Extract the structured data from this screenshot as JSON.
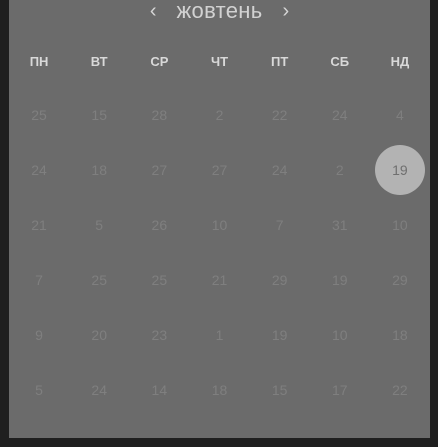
{
  "calendar": {
    "month": "жовтень",
    "prev_icon": "‹",
    "next_icon": "›",
    "weekdays": [
      "ПН",
      "ВТ",
      "СР",
      "ЧТ",
      "ПТ",
      "СБ",
      "НД"
    ],
    "weeks": [
      [
        "25",
        "15",
        "28",
        "2",
        "22",
        "24",
        "4"
      ],
      [
        "24",
        "18",
        "27",
        "27",
        "24",
        "2",
        "19"
      ],
      [
        "21",
        "5",
        "26",
        "10",
        "7",
        "31",
        "10"
      ],
      [
        "7",
        "25",
        "25",
        "21",
        "29",
        "19",
        "29"
      ],
      [
        "9",
        "20",
        "23",
        "1",
        "19",
        "10",
        "18"
      ],
      [
        "5",
        "24",
        "14",
        "18",
        "15",
        "17",
        "22"
      ]
    ],
    "selected_day": "19"
  },
  "colors": {
    "panel": "#6b6b6b",
    "background": "#1f1f1f",
    "selected": "#b3b3b3"
  }
}
